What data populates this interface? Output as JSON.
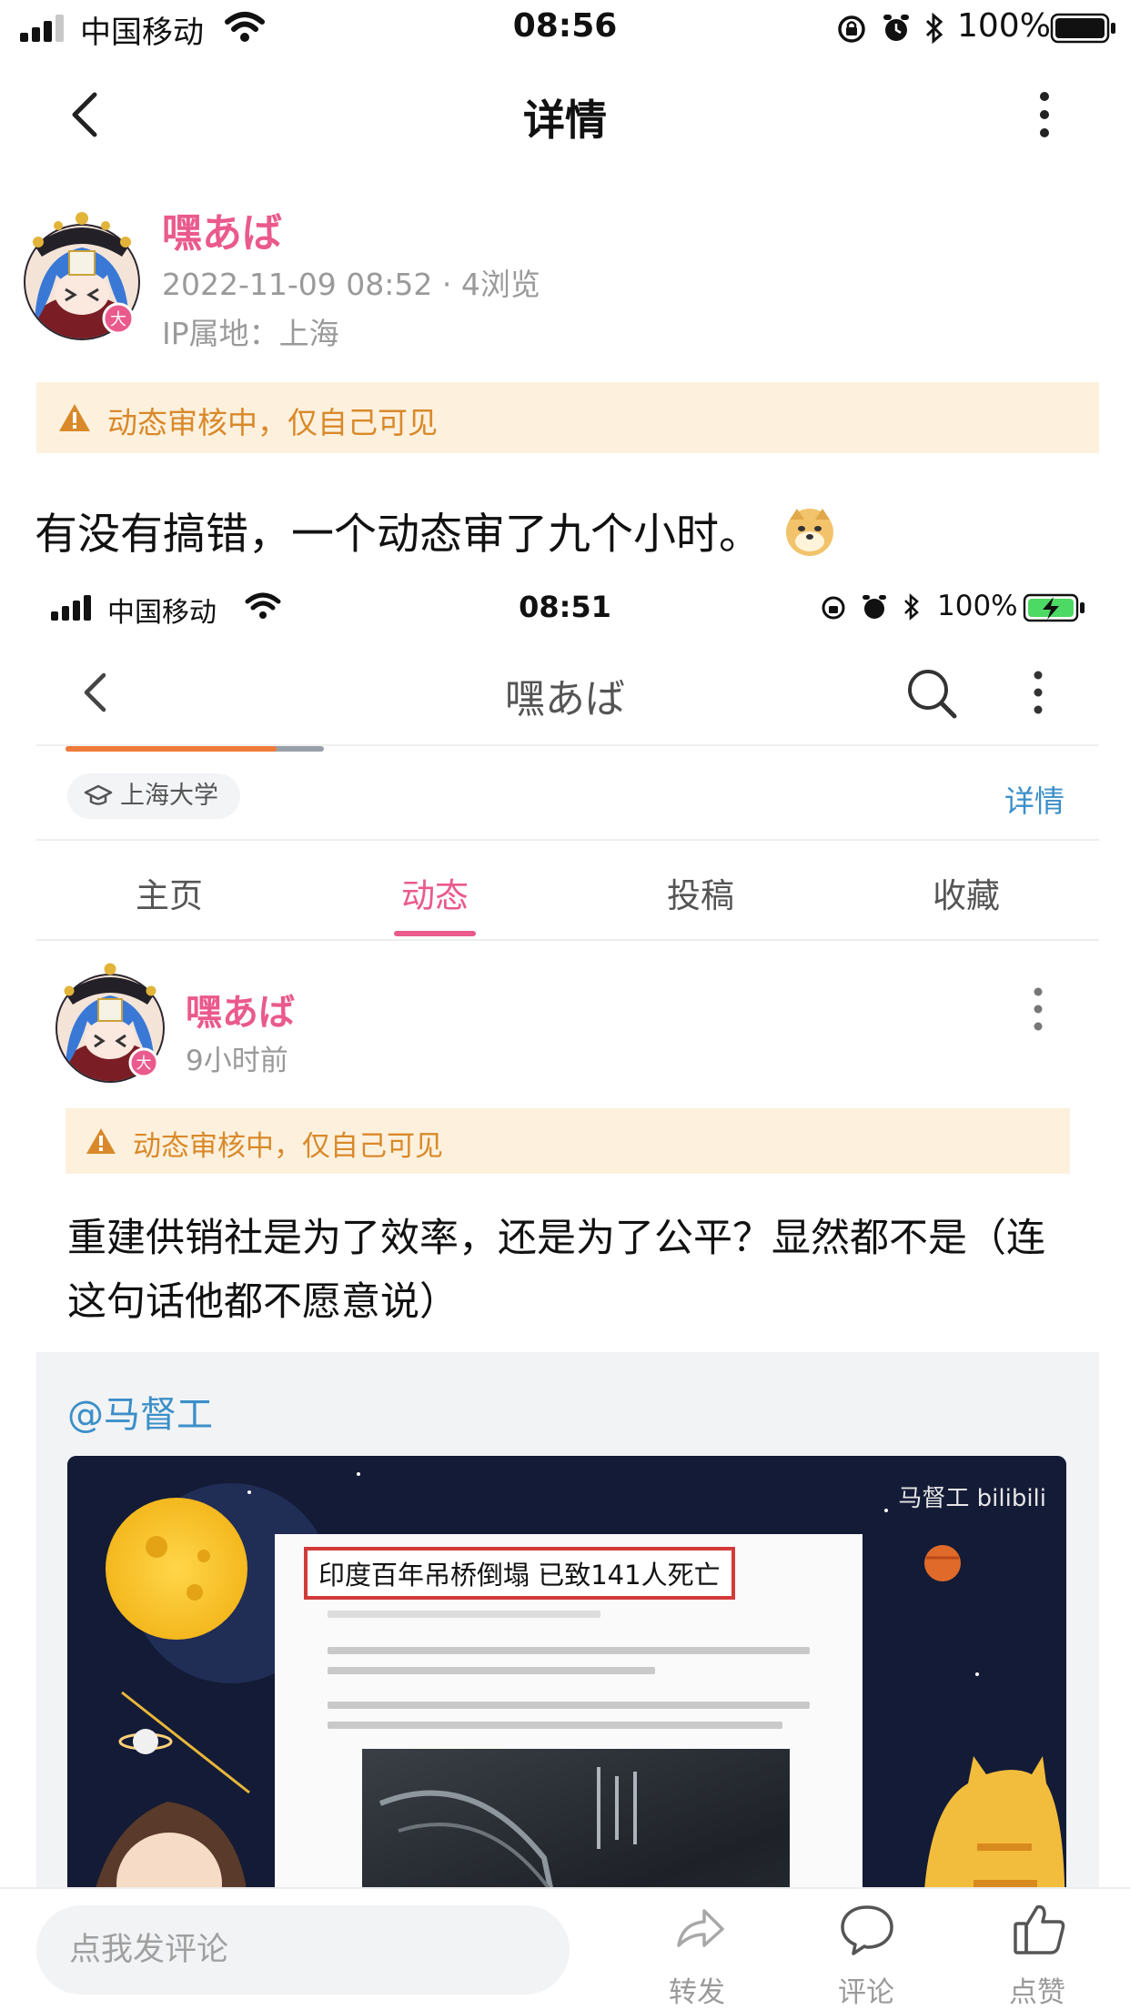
{
  "status_bar": {
    "carrier": "中国移动",
    "time": "08:56",
    "battery": "100%"
  },
  "nav": {
    "title": "详情"
  },
  "author": {
    "name": "嘿あば",
    "meta": "2022-11-09 08:52 · 4浏览",
    "ip": "IP属地：上海",
    "badge": "大"
  },
  "review_banner": "动态审核中，仅自己可见",
  "post": {
    "text": "有没有搞错，一个动态审了九个小时。",
    "emoji": "🐶"
  },
  "screenshot": {
    "status_bar": {
      "carrier": "中国移动",
      "time": "08:51",
      "battery": "100%"
    },
    "nav_title": "嘿あば",
    "school": "上海大学",
    "detail_link": "详情",
    "tabs": [
      {
        "label": "主页"
      },
      {
        "label": "动态"
      },
      {
        "label": "投稿"
      },
      {
        "label": "收藏"
      }
    ],
    "author": {
      "name": "嘿あば",
      "time": "9小时前",
      "badge": "大"
    },
    "review_banner": "动态审核中，仅自己可见",
    "post_text": "重建供销社是为了效率，还是为了公平？显然都不是（连这句话他都不愿意说）",
    "quote": {
      "mention": "@马督工",
      "video_headline": "印度百年吊桥倒塌 已致141人死亡",
      "brand": "马督工 bilibili"
    }
  },
  "bottom_bar": {
    "comment_placeholder": "点我发评论",
    "forward": "转发",
    "comment": "评论",
    "like": "点赞"
  },
  "colors": {
    "accent_pink": "#ea5a8c",
    "link_blue": "#3b8fc8",
    "warning_orange": "#d9892a",
    "warning_bg": "#fdf1de"
  }
}
